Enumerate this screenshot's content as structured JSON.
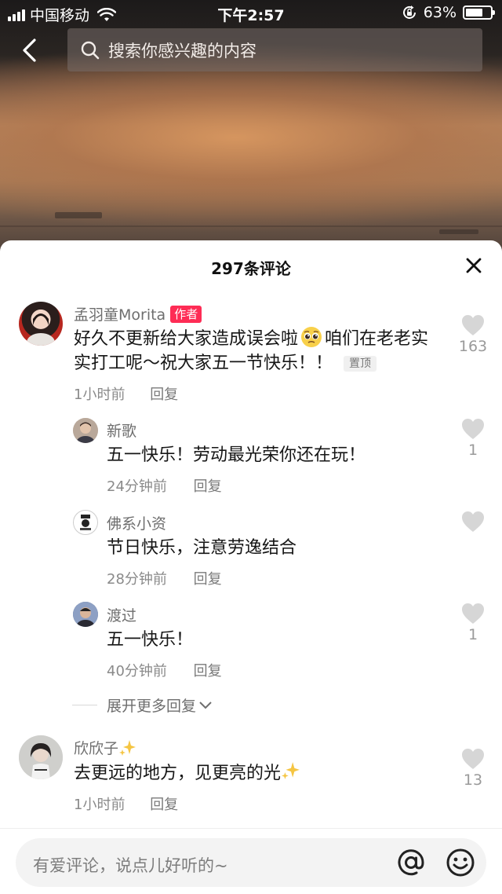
{
  "status_bar": {
    "carrier": "中国移动",
    "time": "下午2:57",
    "battery_percent": "63%",
    "battery_level": 0.63
  },
  "search": {
    "placeholder": "搜索你感兴趣的内容"
  },
  "comments_panel": {
    "title": "297条评论",
    "comments": [
      {
        "nickname": "孟羽童Morita",
        "author_tag": "作者",
        "text_part1": "好久不更新给大家造成误会啦",
        "emoji": "pleading-face",
        "text_part2": "咱们在老老实实打工呢～祝大家五一节快乐！！",
        "pin_tag": "置顶",
        "time": "1小时前",
        "reply_label": "回复",
        "likes": "163",
        "replies": [
          {
            "nickname": "新歌",
            "text": "五一快乐！劳动最光荣你还在玩！",
            "time": "24分钟前",
            "reply_label": "回复",
            "likes": "1"
          },
          {
            "nickname": "佛系小资",
            "text": "节日快乐，注意劳逸结合",
            "time": "28分钟前",
            "reply_label": "回复",
            "likes": ""
          },
          {
            "nickname": "渡过",
            "text": "五一快乐！",
            "time": "40分钟前",
            "reply_label": "回复",
            "likes": "1"
          }
        ],
        "expand_label": "展开更多回复"
      },
      {
        "nickname": "欣欣子",
        "text": "去更远的地方，见更亮的光",
        "time": "1小时前",
        "reply_label": "回复",
        "likes": "13"
      }
    ]
  },
  "input": {
    "placeholder": "有爱评论，说点儿好听的~"
  },
  "colors": {
    "author_tag": "#fe2c55",
    "like_icon": "#d6d6d6",
    "sparkle": "#f5c542"
  },
  "icons": [
    "back-arrow-icon",
    "search-icon",
    "close-icon",
    "heart-icon",
    "at-icon",
    "emoji-icon",
    "sparkle-icon",
    "chevron-down-icon"
  ]
}
